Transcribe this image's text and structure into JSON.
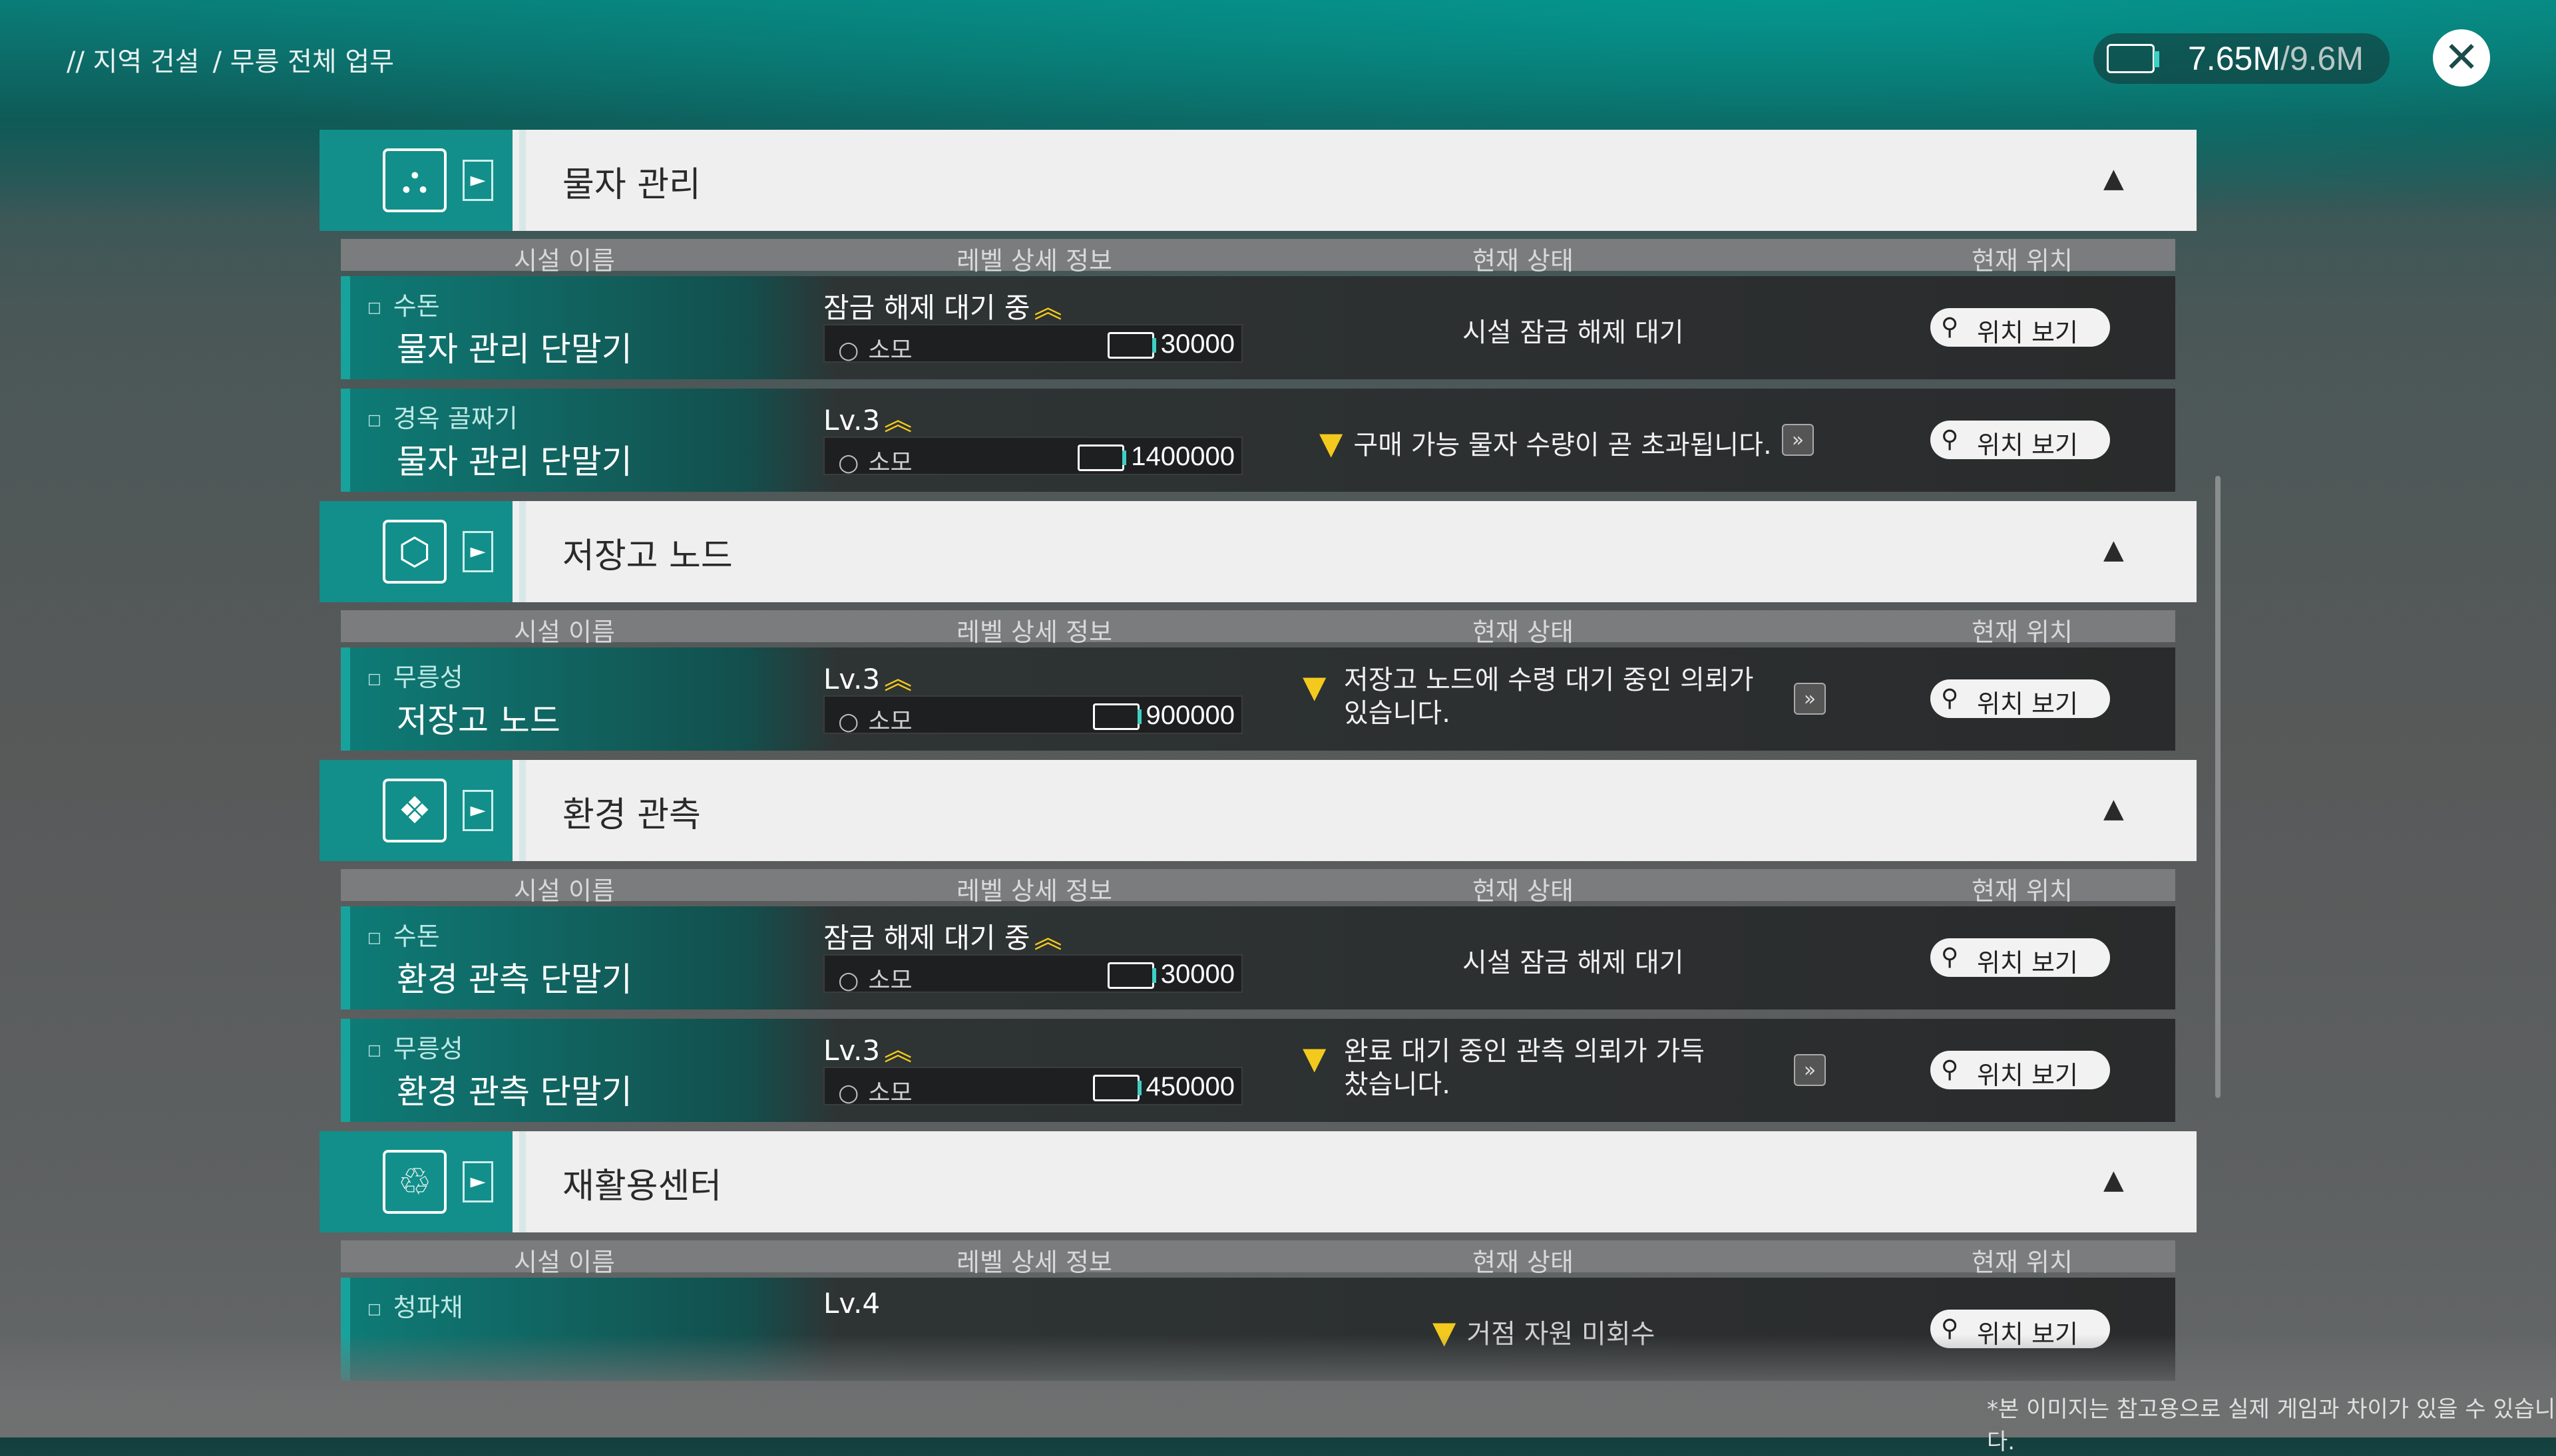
{
  "header": {
    "breadcrumb": [
      "// 지역 건설",
      "/ 무릉 전체 업무"
    ],
    "currency": {
      "icon": "ticket-icon",
      "current": "7.65M",
      "max": "/9.6M"
    },
    "close_icon": "close-icon"
  },
  "columns": [
    "시설 이름",
    "레벨 상세 정보",
    "현재 상태",
    "현재 위치"
  ],
  "categories": [
    {
      "title": "물자 관리",
      "icon": "supply-icon",
      "toggle": "▲",
      "rows": [
        {
          "location": "수돈",
          "name": "물자 관리 단말기",
          "level": "잠금 해제 대기 중",
          "cost_label": "소모",
          "cost": "30000",
          "status": "시설 잠금 해제 대기",
          "warning": false,
          "location_button": "위치 보기"
        },
        {
          "location": "경옥 골짜기",
          "name": "물자 관리 단말기",
          "level": "Lv.3",
          "cost_label": "소모",
          "cost": "1400000",
          "status": "구매 가능 물자 수량이 곧 초과됩니다.",
          "warning": true,
          "location_button": "위치 보기"
        }
      ]
    },
    {
      "title": "저장고 노드",
      "icon": "storage-icon",
      "toggle": "▲",
      "rows": [
        {
          "location": "무릉성",
          "name": "저장고 노드",
          "level": "Lv.3",
          "cost_label": "소모",
          "cost": "900000",
          "status": "저장고 노드에 수령 대기 중인 의뢰가",
          "status2": "있습니다.",
          "warning": true,
          "location_button": "위치 보기"
        }
      ]
    },
    {
      "title": "환경 관측",
      "icon": "observe-icon",
      "toggle": "▲",
      "rows": [
        {
          "location": "수돈",
          "name": "환경 관측 단말기",
          "level": "잠금 해제 대기 중",
          "cost_label": "소모",
          "cost": "30000",
          "status": "시설 잠금 해제 대기",
          "warning": false,
          "location_button": "위치 보기"
        },
        {
          "location": "무릉성",
          "name": "환경 관측 단말기",
          "level": "Lv.3",
          "cost_label": "소모",
          "cost": "450000",
          "status": "완료 대기 중인 관측 의뢰가 가득",
          "status2": "찼습니다.",
          "warning": true,
          "location_button": "위치 보기"
        }
      ]
    },
    {
      "title": "재활용센터",
      "icon": "recycle-icon",
      "toggle": "▲",
      "rows": [
        {
          "location": "청파채",
          "name": "",
          "level": "Lv.4",
          "status": "거점 자원 미회수",
          "warning": true,
          "location_button": "위치 보기"
        }
      ]
    }
  ],
  "footnote": "*본 이미지는 참고용으로 실제 게임과 차이가 있을 수 있습니다.",
  "colors": {
    "accent": "#128f8a",
    "warning": "#f4c91e",
    "row_bg": "#2a2b2c"
  }
}
